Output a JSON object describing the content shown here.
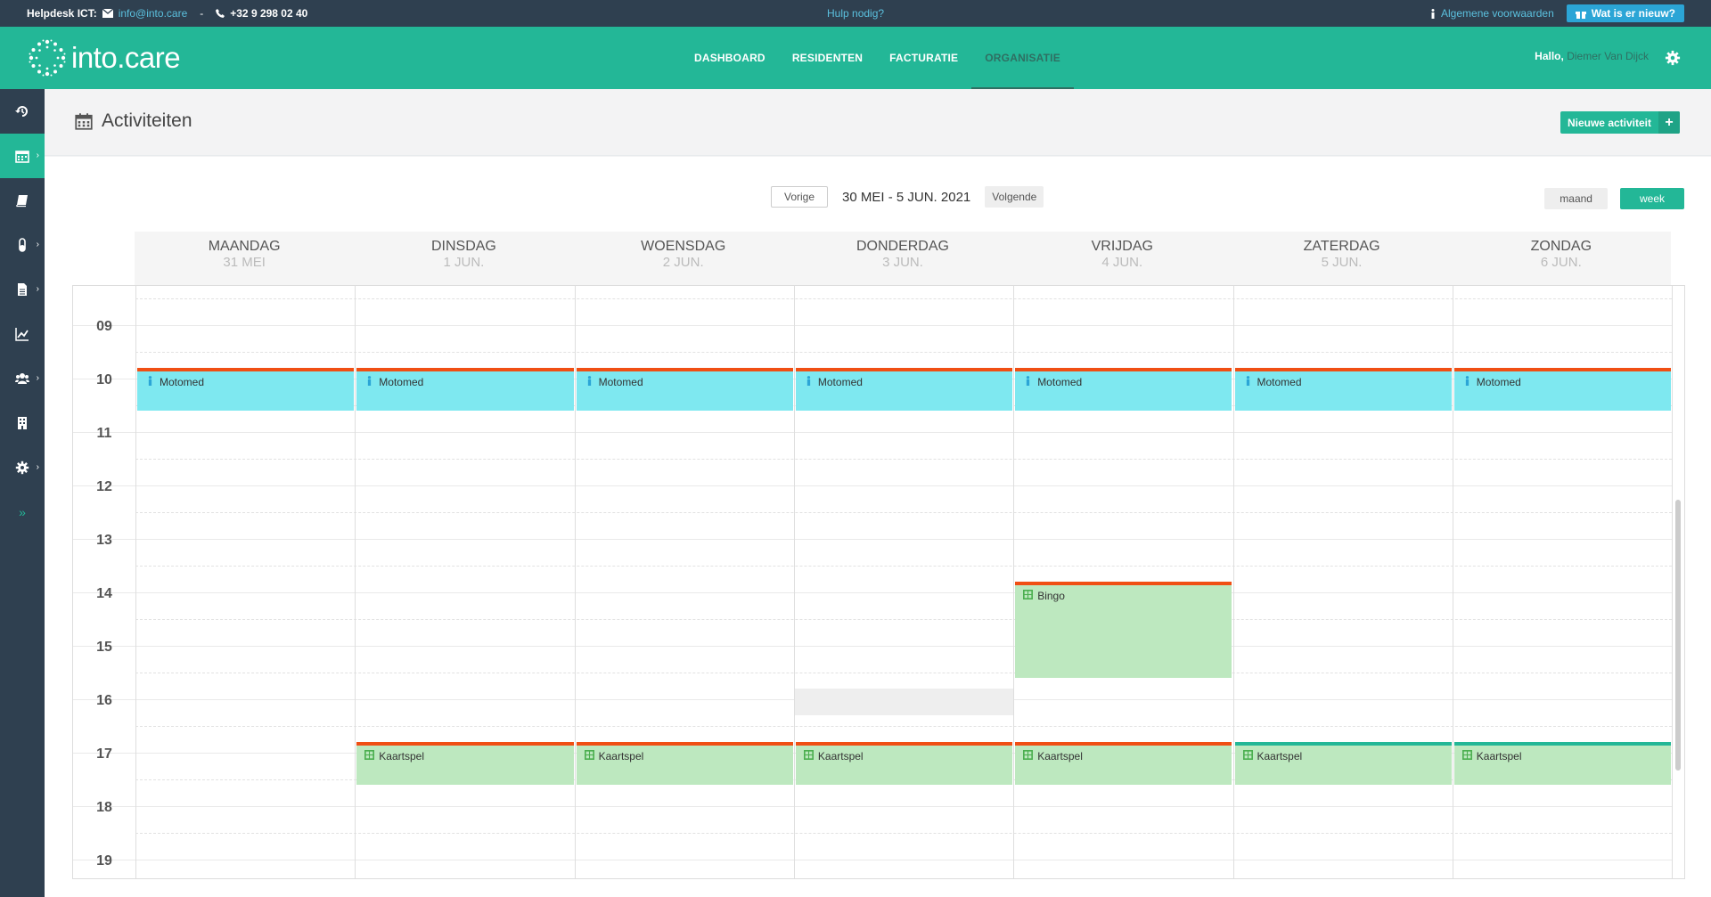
{
  "topbar": {
    "helpdesk_label": "Helpdesk ICT:",
    "email": "info@into.care",
    "separator": "-",
    "phone": "+32 9 298 02 40",
    "help_link": "Hulp nodig?",
    "terms_link": "Algemene voorwaarden",
    "whatsnew_label": "Wat is er nieuw?"
  },
  "header": {
    "logo_text": "into.care",
    "nav": [
      "DASHBOARD",
      "RESIDENTEN",
      "FACTURATIE",
      "ORGANISATIE"
    ],
    "active_nav": "ORGANISATIE",
    "greeting": "Hallo,",
    "user_name": "Diemer Van Dijck"
  },
  "page": {
    "title": "Activiteiten",
    "new_button": "Nieuwe activiteit"
  },
  "calendar": {
    "prev_label": "Vorige",
    "range_label": "30 MEI - 5 JUN. 2021",
    "next_label": "Volgende",
    "month_label": "maand",
    "week_label": "week",
    "days": [
      {
        "name": "MAANDAG",
        "date": "31 MEI"
      },
      {
        "name": "DINSDAG",
        "date": "1 JUN."
      },
      {
        "name": "WOENSDAG",
        "date": "2 JUN."
      },
      {
        "name": "DONDERDAG",
        "date": "3 JUN."
      },
      {
        "name": "VRIJDAG",
        "date": "4 JUN."
      },
      {
        "name": "ZATERDAG",
        "date": "5 JUN."
      },
      {
        "name": "ZONDAG",
        "date": "6 JUN."
      }
    ],
    "hours": [
      "09",
      "10",
      "11",
      "12",
      "13",
      "14",
      "15",
      "16",
      "17",
      "18",
      "19"
    ],
    "events": [
      {
        "title": "Motomed",
        "day": 0,
        "start": 10,
        "end": 11,
        "color": "cyan",
        "bar": "red",
        "icon": "person-icon"
      },
      {
        "title": "Motomed",
        "day": 1,
        "start": 10,
        "end": 11,
        "color": "cyan",
        "bar": "red",
        "icon": "person-icon"
      },
      {
        "title": "Motomed",
        "day": 2,
        "start": 10,
        "end": 11,
        "color": "cyan",
        "bar": "red",
        "icon": "person-icon"
      },
      {
        "title": "Motomed",
        "day": 3,
        "start": 10,
        "end": 11,
        "color": "cyan",
        "bar": "red",
        "icon": "person-icon"
      },
      {
        "title": "Motomed",
        "day": 4,
        "start": 10,
        "end": 11,
        "color": "cyan",
        "bar": "red",
        "icon": "person-icon"
      },
      {
        "title": "Motomed",
        "day": 5,
        "start": 10,
        "end": 11,
        "color": "cyan",
        "bar": "red",
        "icon": "person-icon"
      },
      {
        "title": "Motomed",
        "day": 6,
        "start": 10,
        "end": 11,
        "color": "cyan",
        "bar": "red",
        "icon": "person-icon"
      },
      {
        "title": "Bingo",
        "day": 4,
        "start": 14,
        "end": 16,
        "color": "green",
        "bar": "red",
        "icon": "grid-icon"
      },
      {
        "title": "Kaartspel",
        "day": 1,
        "start": 17,
        "end": 18,
        "color": "green",
        "bar": "red",
        "icon": "grid-icon"
      },
      {
        "title": "Kaartspel",
        "day": 2,
        "start": 17,
        "end": 18,
        "color": "green",
        "bar": "red",
        "icon": "grid-icon"
      },
      {
        "title": "Kaartspel",
        "day": 3,
        "start": 17,
        "end": 18,
        "color": "green",
        "bar": "red",
        "icon": "grid-icon"
      },
      {
        "title": "Kaartspel",
        "day": 4,
        "start": 17,
        "end": 18,
        "color": "green",
        "bar": "red",
        "icon": "grid-icon"
      },
      {
        "title": "Kaartspel",
        "day": 5,
        "start": 17,
        "end": 18,
        "color": "green",
        "bar": "teal",
        "icon": "grid-icon"
      },
      {
        "title": "Kaartspel",
        "day": 6,
        "start": 17,
        "end": 18,
        "color": "green",
        "bar": "teal",
        "icon": "grid-icon"
      }
    ],
    "unavailable": [
      {
        "day": 3,
        "start": 16,
        "end": 16.5
      }
    ]
  },
  "colors": {
    "brand": "#23b797",
    "dark": "#2f4050",
    "event_cyan": "#7ee8f0",
    "event_green": "#bde8bf",
    "bar_red": "#f04f14"
  }
}
